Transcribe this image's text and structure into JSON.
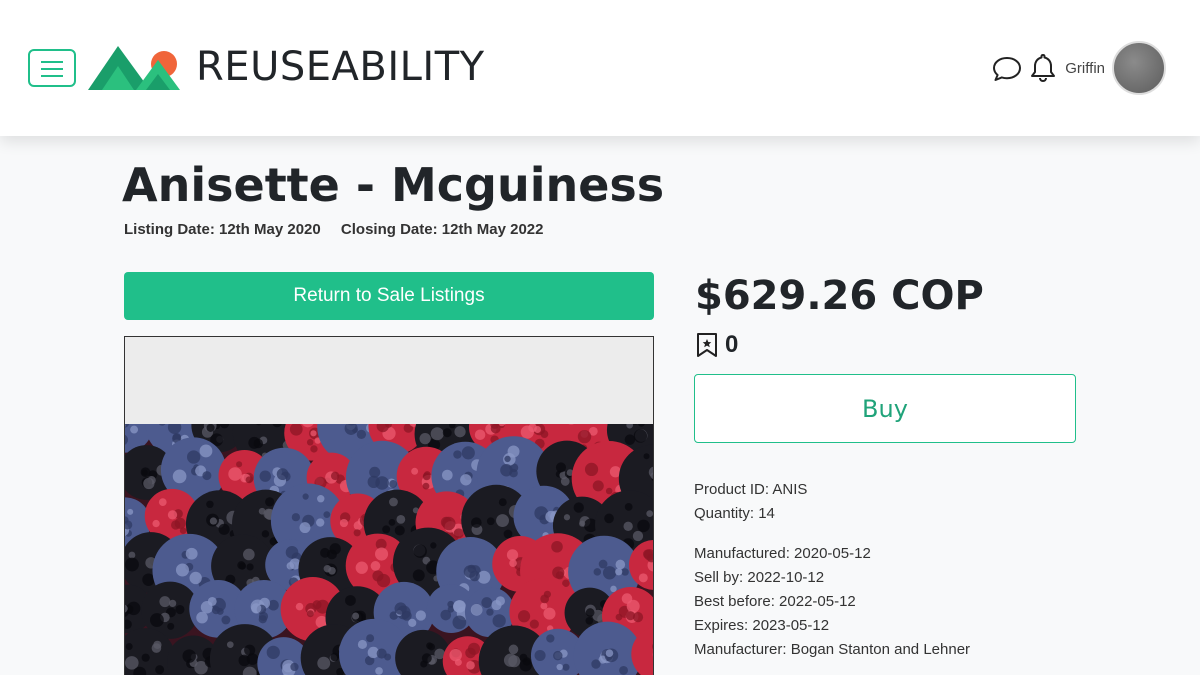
{
  "header": {
    "brand": "REUSEABILITY",
    "username": "Griffin",
    "icons": [
      "menu-icon",
      "messages-icon",
      "notifications-icon"
    ]
  },
  "listing": {
    "title": "Anisette - Mcguiness",
    "listing_date": "Listing Date: 12th May 2020",
    "closing_date": "Closing Date: 12th May 2022",
    "return_button": "Return to Sale Listings",
    "price": "$629.26 COP",
    "bookmark_count": "0",
    "buy_button": "Buy"
  },
  "product": {
    "product_id": "Product ID: ANIS",
    "quantity": "Quantity: 14",
    "manufactured": "Manufactured: 2020-05-12",
    "sell_by": "Sell by: 2022-10-12",
    "best_before": "Best before: 2022-05-12",
    "expires": "Expires: 2023-05-12",
    "manufacturer": "Manufacturer: Bogan Stanton and Lehner"
  },
  "colors": {
    "accent": "#20bf8a",
    "logo_green_dark": "#1a9e6a",
    "logo_green_light": "#2bc07e",
    "logo_orange": "#f0653a"
  }
}
